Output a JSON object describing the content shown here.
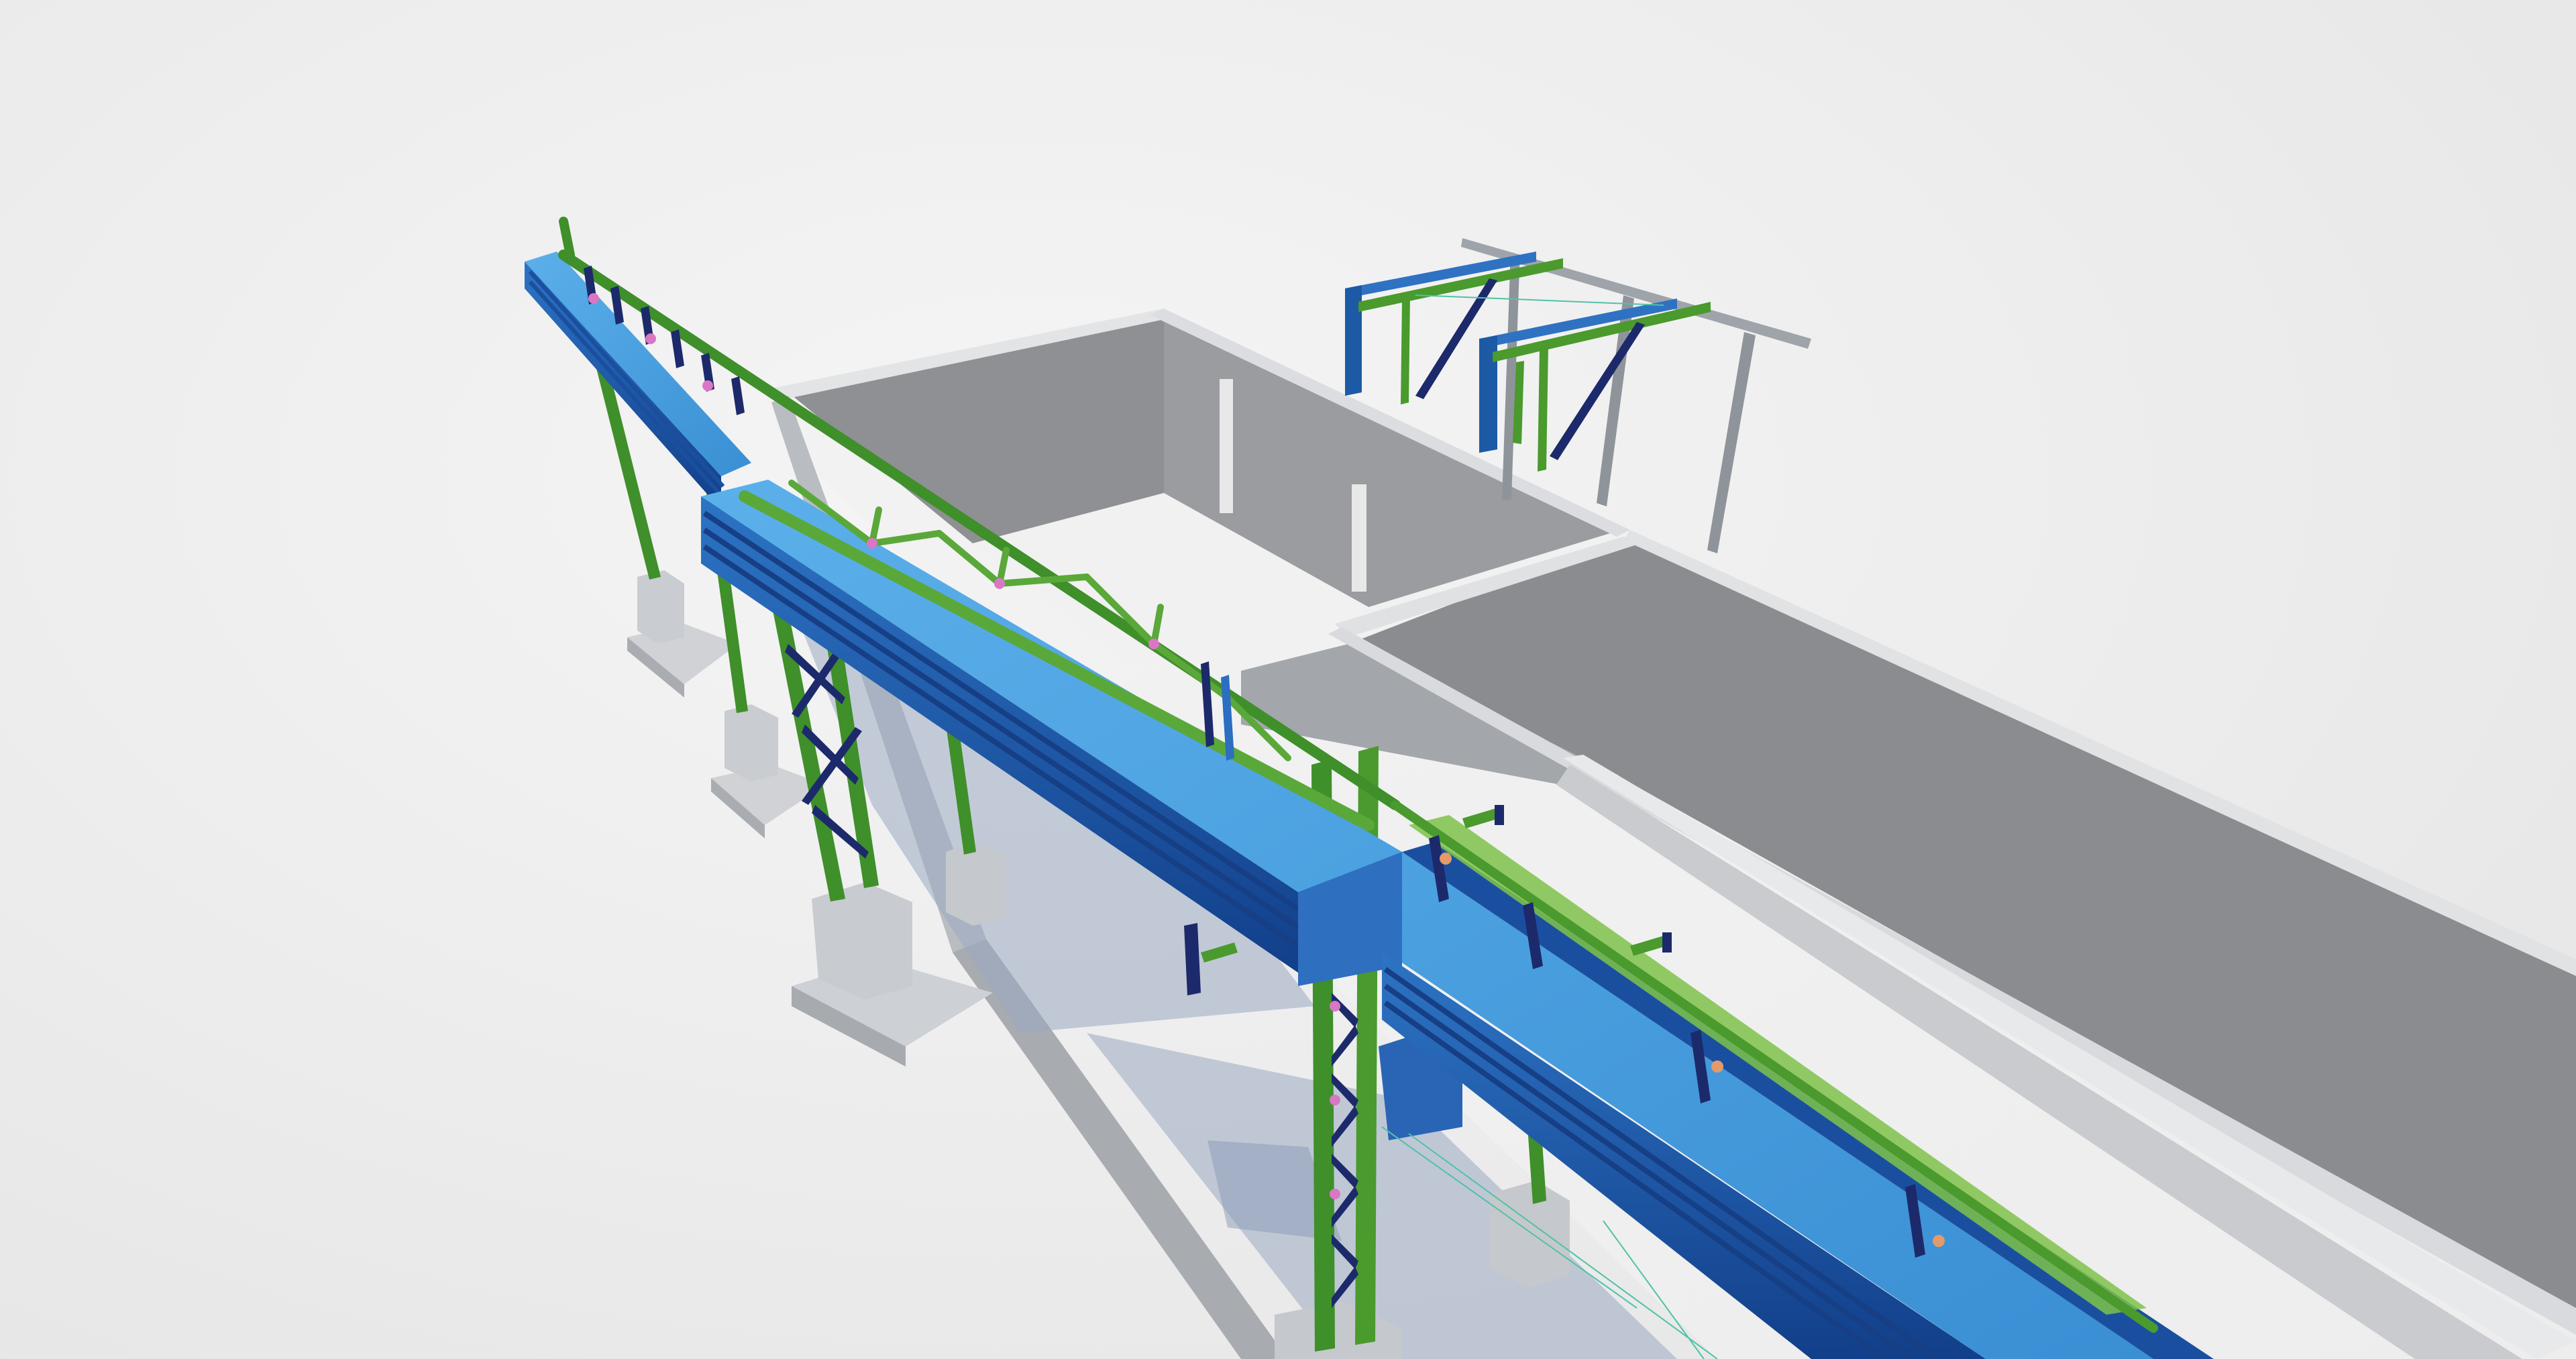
{
  "viewer": {
    "mode": "3d-model-viewport"
  },
  "palette": {
    "background": "#ececec",
    "concrete_wall_top": "#e6e7e9",
    "concrete_wall_inner": "#8d8f92",
    "concrete_wall_side": "#b8bbc0",
    "floor": "#f2f2f2",
    "steel_green": "#3f8f2a",
    "steel_green_light": "#7fc24a",
    "conveyor_light_blue": "#4fa3e0",
    "conveyor_dark_blue": "#1a4fa0",
    "bracing_navy": "#1c2a6b",
    "connection_pink": "#d977c4",
    "shadow": "#8fa2bf"
  },
  "scene_objects": [
    {
      "name": "concrete-building",
      "kind": "concrete-walls"
    },
    {
      "name": "conveyor-gallery",
      "kind": "conveyor-truss"
    },
    {
      "name": "support-trestle",
      "kind": "steel-column"
    },
    {
      "name": "concrete-footing",
      "kind": "foundation"
    },
    {
      "name": "pipe-rack-frame",
      "kind": "steel-frame"
    }
  ]
}
